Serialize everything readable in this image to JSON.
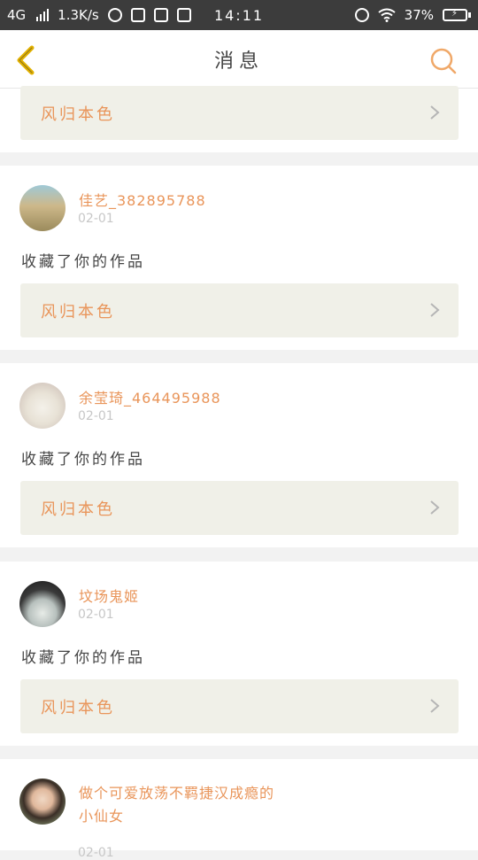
{
  "status_bar": {
    "network": "4G",
    "speed": "1.3K/s",
    "time": "14:11",
    "battery": "37%"
  },
  "header": {
    "title": "消息"
  },
  "cards": [
    {
      "work": "风归本色"
    },
    {
      "user": "佳艺_382895788",
      "date": "02-01",
      "action": "收藏了你的作品",
      "work": "风归本色"
    },
    {
      "user": "余莹琦_464495988",
      "date": "02-01",
      "action": "收藏了你的作品",
      "work": "风归本色"
    },
    {
      "user": "坟场鬼姬",
      "date": "02-01",
      "action": "收藏了你的作品",
      "work": "风归本色"
    },
    {
      "user_line1": "做个可爱放荡不羁捷汉成瘾的",
      "user_line2": "小仙女",
      "date": "02-01"
    }
  ],
  "colors": {
    "accent": "#e9955a",
    "header_back": "#e2b100",
    "work_bg": "#f0f0e8"
  },
  "icons": [
    "back-arrow-icon",
    "search-icon",
    "chevron-right-icon"
  ]
}
